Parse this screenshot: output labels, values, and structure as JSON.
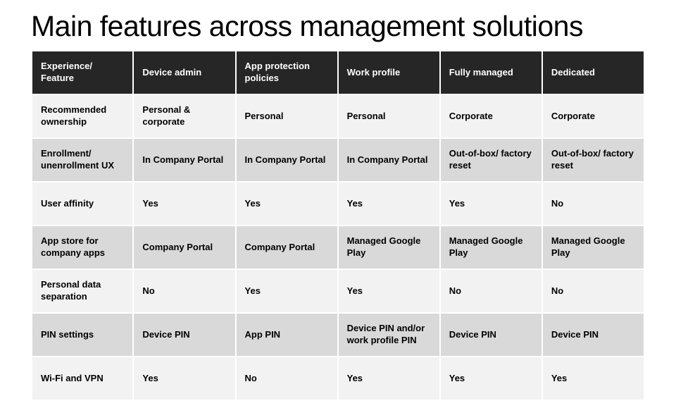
{
  "title": "Main features across management solutions",
  "chart_data": {
    "type": "table",
    "columns": [
      "Experience/ Feature",
      "Device admin",
      "App protection policies",
      "Work profile",
      "Fully managed",
      "Dedicated"
    ],
    "rows": [
      {
        "feature": "Recommended ownership",
        "cells": [
          "Personal & corporate",
          "Personal",
          "Personal",
          "Corporate",
          "Corporate"
        ]
      },
      {
        "feature": "Enrollment/ unenrollment UX",
        "cells": [
          "In Company Portal",
          "In Company Portal",
          "In Company Portal",
          "Out-of-box/ factory reset",
          "Out-of-box/ factory reset"
        ]
      },
      {
        "feature": "User affinity",
        "cells": [
          "Yes",
          "Yes",
          "Yes",
          "Yes",
          "No"
        ]
      },
      {
        "feature": "App store for company apps",
        "cells": [
          "Company Portal",
          "Company Portal",
          "Managed Google Play",
          "Managed Google Play",
          "Managed Google Play"
        ]
      },
      {
        "feature": "Personal data separation",
        "cells": [
          "No",
          "Yes",
          "Yes",
          "No",
          "No"
        ]
      },
      {
        "feature": "PIN settings",
        "cells": [
          "Device PIN",
          "App PIN",
          "Device PIN and/or work profile PIN",
          "Device PIN",
          "Device PIN"
        ]
      },
      {
        "feature": "Wi-Fi and VPN",
        "cells": [
          "Yes",
          "No",
          "Yes",
          "Yes",
          "Yes"
        ]
      }
    ]
  }
}
